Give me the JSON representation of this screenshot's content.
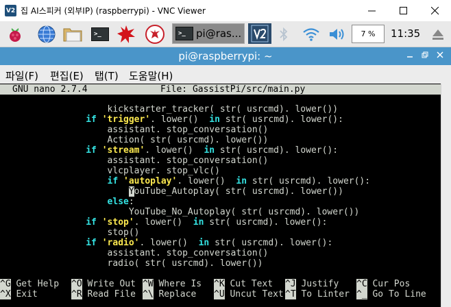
{
  "window": {
    "icon_text": "V2",
    "title": "집 AI스피커 (외부IP) (raspberrypi) - VNC Viewer"
  },
  "panel": {
    "tasks": [
      {
        "label": "pi@ras..."
      }
    ],
    "cpu": "7 %",
    "clock": "11:35",
    "term_icon_text": ">_"
  },
  "terminal": {
    "title": "pi@raspberrypi: ~",
    "menu": [
      "파일(F)",
      "편집(E)",
      "탭(T)",
      "도움말(H)"
    ]
  },
  "nano": {
    "version": "GNU nano 2.7.4",
    "file_label": "File: GassistPi/src/main.py",
    "shortcuts_row1": [
      {
        "key": "^G",
        "label": "Get Help"
      },
      {
        "key": "^O",
        "label": "Write Out"
      },
      {
        "key": "^W",
        "label": "Where Is"
      },
      {
        "key": "^K",
        "label": "Cut Text"
      },
      {
        "key": "^J",
        "label": "Justify"
      },
      {
        "key": "^C",
        "label": "Cur Pos"
      }
    ],
    "shortcuts_row2": [
      {
        "key": "^X",
        "label": "Exit"
      },
      {
        "key": "^R",
        "label": "Read File"
      },
      {
        "key": "^\\",
        "label": "Replace"
      },
      {
        "key": "^U",
        "label": "Uncut Text"
      },
      {
        "key": "^T",
        "label": "To Linter"
      },
      {
        "key": "^_",
        "label": "Go To Line"
      }
    ]
  },
  "code_lines": [
    [
      {
        "t": "                    kickstarter_tracker( str( usrcmd). lower())"
      }
    ],
    [
      {
        "t": "                "
      },
      {
        "t": "if ",
        "c": "kw"
      },
      {
        "t": "'trigger'",
        "c": "str"
      },
      {
        "t": ". lower()  "
      },
      {
        "t": "in",
        "c": "kw"
      },
      {
        "t": " str( usrcmd). lower():"
      }
    ],
    [
      {
        "t": "                    assistant. stop_conversation()"
      }
    ],
    [
      {
        "t": "                    Action( str( usrcmd). lower())"
      }
    ],
    [
      {
        "t": "                "
      },
      {
        "t": "if ",
        "c": "kw"
      },
      {
        "t": "'stream'",
        "c": "str"
      },
      {
        "t": ". lower()  "
      },
      {
        "t": "in",
        "c": "kw"
      },
      {
        "t": " str( usrcmd). lower():"
      }
    ],
    [
      {
        "t": "                    assistant. stop_conversation()"
      }
    ],
    [
      {
        "t": "                    vlcplayer. stop_vlc()"
      }
    ],
    [
      {
        "t": "                    "
      },
      {
        "t": "if ",
        "c": "kw"
      },
      {
        "t": "'autoplay'",
        "c": "str"
      },
      {
        "t": ". lower()  "
      },
      {
        "t": "in",
        "c": "kw"
      },
      {
        "t": " str( usrcmd). lower():"
      }
    ],
    [
      {
        "t": "                        "
      },
      {
        "t": "Y",
        "c": "cursor"
      },
      {
        "t": "ouTube_Autoplay( str( usrcmd). lower())"
      }
    ],
    [
      {
        "t": "                    "
      },
      {
        "t": "else",
        "c": "kw"
      },
      {
        "t": ":"
      }
    ],
    [
      {
        "t": "                        YouTube_No_Autoplay( str( usrcmd). lower())"
      }
    ],
    [
      {
        "t": "                "
      },
      {
        "t": "if ",
        "c": "kw"
      },
      {
        "t": "'stop'",
        "c": "str"
      },
      {
        "t": ". lower()  "
      },
      {
        "t": "in",
        "c": "kw"
      },
      {
        "t": " str( usrcmd). lower():"
      }
    ],
    [
      {
        "t": "                    stop()"
      }
    ],
    [
      {
        "t": "                "
      },
      {
        "t": "if ",
        "c": "kw"
      },
      {
        "t": "'radio'",
        "c": "str"
      },
      {
        "t": ". lower()  "
      },
      {
        "t": "in",
        "c": "kw"
      },
      {
        "t": " str( usrcmd). lower():"
      }
    ],
    [
      {
        "t": "                    assistant. stop_conversation()"
      }
    ],
    [
      {
        "t": "                    radio( str( usrcmd). lower())"
      }
    ]
  ]
}
